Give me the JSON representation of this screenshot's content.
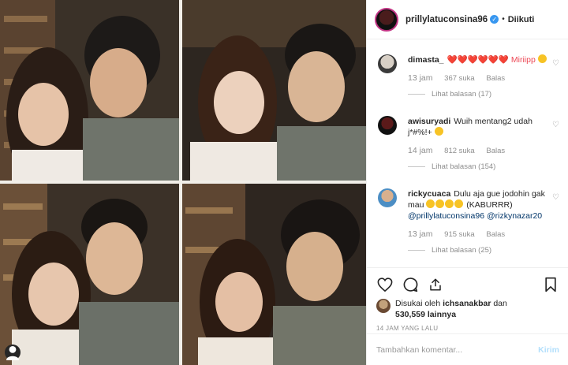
{
  "header": {
    "username": "prillylatuconsina96",
    "separator": "•",
    "follow_status": "Diikuti"
  },
  "comments": [
    {
      "username": "dimasta_",
      "text": "❤️❤️❤️❤️❤️❤️ Miriipp",
      "trailing_emoji": "😛",
      "time": "13 jam",
      "likes": "367 suka",
      "reply_label": "Balas",
      "view_replies": "Lihat balasan (17)"
    },
    {
      "username": "awisuryadi",
      "text": "Wuih mentang2 udah j*#%!+",
      "trailing_emoji": "😄",
      "time": "14 jam",
      "likes": "812 suka",
      "reply_label": "Balas",
      "view_replies": "Lihat balasan (154)"
    },
    {
      "username": "rickycuaca",
      "text_before": "Dulu aja gue jodohin gak mau",
      "text_after": "(KABURRR)",
      "mention1": "@prillylatuconsina96",
      "mention2": "@rizkynazar20",
      "emoji": "🤣🤣🤣🤣",
      "time": "13 jam",
      "likes": "915 suka",
      "reply_label": "Balas",
      "view_replies": "Lihat balasan (25)"
    }
  ],
  "actions": {
    "liked_by_prefix": "Disukai oleh",
    "liked_by_user": "ichsanakbar",
    "liked_by_and": "dan",
    "liked_by_count": "530,559",
    "liked_by_suffix": "lainnya",
    "time_ago": "14 JAM YANG LALU"
  },
  "comment_box": {
    "placeholder": "Tambahkan komentar...",
    "send_label": "Kirim"
  },
  "colors": {
    "link_blue": "#3897f0",
    "send_disabled": "#b2dffc",
    "muted": "#8e8e8e",
    "heart_red": "#ed4956"
  },
  "icons": [
    "heart-icon",
    "comment-icon",
    "share-icon",
    "bookmark-icon",
    "user-tag-icon",
    "verified-badge-icon"
  ]
}
